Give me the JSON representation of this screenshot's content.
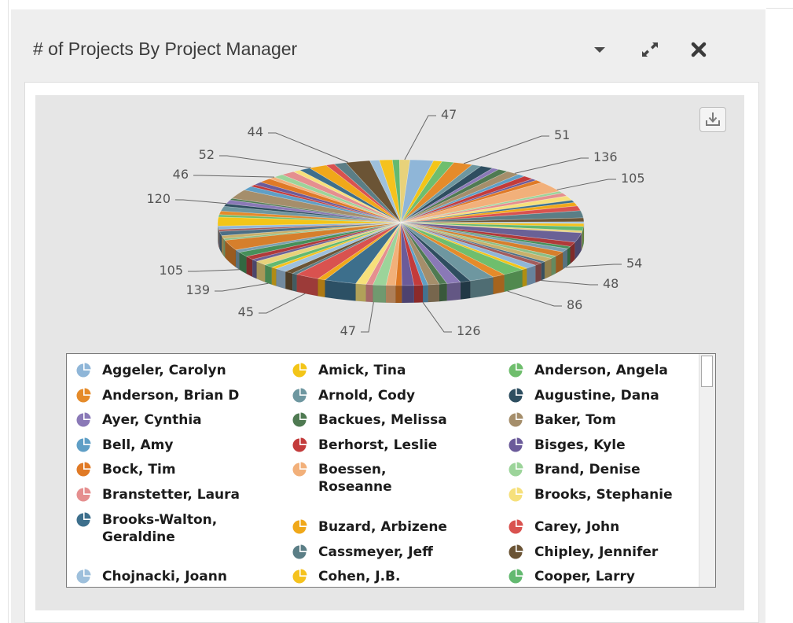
{
  "widget": {
    "title": "# of Projects By Project Manager",
    "icons": {
      "menu": "dropdown-caret-icon",
      "expand": "expand-arrows-icon",
      "close": "close-x-icon",
      "export": "download-icon"
    },
    "colors": {
      "panel_bg": "#eeeeee",
      "chart_bg": "#e6e6e6",
      "title_text": "#3c3c3c"
    }
  },
  "chart_data": {
    "type": "pie",
    "title": "",
    "three_d": true,
    "callout_labels": [
      47,
      51,
      136,
      105,
      54,
      48,
      86,
      126,
      47,
      45,
      139,
      105,
      120,
      46,
      52,
      44
    ],
    "legend_placement": "bottom",
    "series": [
      {
        "name": "Aggeler, Carolyn",
        "color": "#8fb6d8"
      },
      {
        "name": "Amick, Tina",
        "color": "#f3c518"
      },
      {
        "name": "Anderson, Angela",
        "color": "#6fbe6d"
      },
      {
        "name": "Anderson, Brian D",
        "color": "#e58b2a"
      },
      {
        "name": "Arnold, Cody",
        "color": "#6e97a0"
      },
      {
        "name": "Augustine, Dana",
        "color": "#2e4e60"
      },
      {
        "name": "Ayer, Cynthia",
        "color": "#8a79b7"
      },
      {
        "name": "Backues, Melissa",
        "color": "#4f7a52"
      },
      {
        "name": "Baker, Tom",
        "color": "#a58e6b"
      },
      {
        "name": "Bell, Amy",
        "color": "#5f9fc6"
      },
      {
        "name": "Berhorst, Leslie",
        "color": "#c33b3b"
      },
      {
        "name": "Bisges, Kyle",
        "color": "#6b5b9a"
      },
      {
        "name": "Bock, Tim",
        "color": "#e07a26"
      },
      {
        "name": "Boessen, Roseanne",
        "color": "#f2b07a"
      },
      {
        "name": "Brand, Denise",
        "color": "#9cd49a"
      },
      {
        "name": "Branstetter, Laura",
        "color": "#e58f8f"
      },
      {
        "name": "Brooks, Stephanie",
        "color": "#f6e07b"
      },
      {
        "name": "Brooks-Walton, Geraldine",
        "color": "#3d6f8c"
      },
      {
        "name": "Buzard, Arbizene",
        "color": "#f0a81a"
      },
      {
        "name": "Carey, John",
        "color": "#d9524f"
      },
      {
        "name": "Cassmeyer, Jeff",
        "color": "#5b7e86"
      },
      {
        "name": "Chipley, Jennifer",
        "color": "#6b5435"
      },
      {
        "name": "Chojnacki, Joann",
        "color": "#9ec0dc"
      },
      {
        "name": "Cohen, J.B.",
        "color": "#f5c21e"
      },
      {
        "name": "Cooper, Larry",
        "color": "#63b970"
      }
    ]
  }
}
